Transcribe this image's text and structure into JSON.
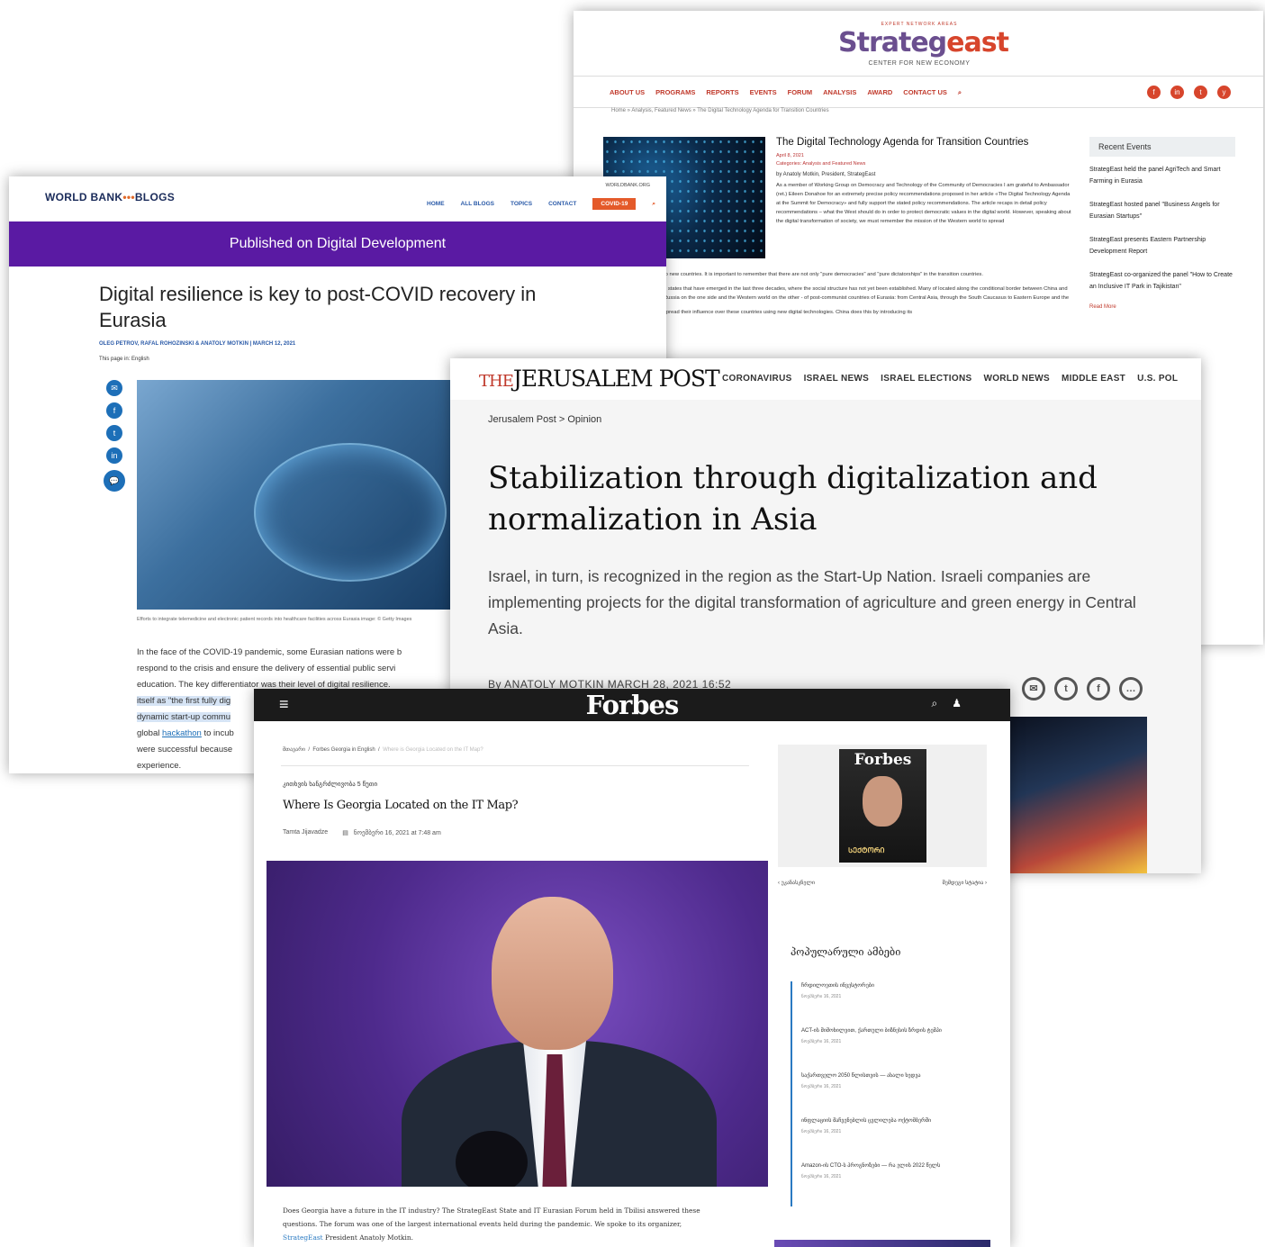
{
  "strategeast": {
    "tagline": "EXPERT NETWORK AREAS",
    "logo_a": "Strateg",
    "logo_b": "east",
    "subtitle": "CENTER FOR NEW ECONOMY",
    "nav": [
      "ABOUT US",
      "PROGRAMS",
      "REPORTS",
      "EVENTS",
      "FORUM",
      "ANALYSIS",
      "AWARD",
      "CONTACT US"
    ],
    "search_icon": "search-icon",
    "social": [
      "f",
      "in",
      "t",
      "y"
    ],
    "breadcrumb": "Home » Analysis, Featured News » The Digital Technology Agenda for Transition Countries",
    "title": "The Digital Technology Agenda for Transition Countries",
    "date": "April 8, 2021",
    "categories": "Categories: Analysis and Featured News",
    "author": "by Anatoly Motkin, President, StrategEast",
    "body": [
      "As a member of Working Group on Democracy and Technology of the Community of Democracies I am grateful to Ambassador (ret.) Eileen Donahoe for an extremely precise policy recommendations proposed in her article «The Digital Technology Agenda at the Summit for Democracy» and fully support the stated policy recommendations. The article recaps in detail policy recommendations – what the West should do in order to protect democratic values in the digital world. However, speaking about the digital transformation of society, we must remember the mission of the Western world to spread",
      "to new countries. It is important to remember that there are not only \"pure democracies\" and \"pure dictatorships\" in the transition countries.",
      "d states that have emerged in the last three decades, where the social structure has not yet been established. Many of located along the conditional border between China and Russia on the one side and the Western world on the other - of post-communist countries of Eurasia: from Central Asia, through the South Caucasus to Eastern Europe and the",
      "spread their influence over these countries using new digital technologies. China does this by introducing its"
    ],
    "sidebar_title": "Recent Events",
    "sidebar_items": [
      "StrategEast held the panel AgriTech and Smart Farming in Eurasia",
      "StrategEast hosted panel \"Business Angels for Eurasian Startups\"",
      "StrategEast presents Eastern Partnership Development Report",
      "StrategEast co-organized the panel \"How to Create an Inclusive IT Park in Tajikistan\""
    ],
    "read_more": "Read More"
  },
  "worldbank": {
    "logo_left": "WORLD BANK",
    "logo_dots": "•••",
    "logo_right": "BLOGS",
    "domain": "WORLDBANK.ORG",
    "nav": [
      "HOME",
      "ALL BLOGS",
      "TOPICS",
      "CONTACT"
    ],
    "covid": "COVID-19",
    "banner": "Published on Digital Development",
    "title": "Digital resilience is key to post-COVID recovery in Eurasia",
    "authors": "OLEG PETROV, RAFAL ROHOZINSKI & ANATOLY MOTKIN  |  MARCH 12, 2021",
    "language": "This page in:  English",
    "share": [
      "✉",
      "f",
      "t",
      "in",
      "💬"
    ],
    "caption": "Efforts to integrate telemedicine and electronic patient records into healthcare facilities across Eurasia image: © Getty Images",
    "body_1": "In the face of the COVID-19 pandemic, some Eurasian nations were b",
    "body_2": "respond to the crisis and ensure the delivery of essential public servi",
    "body_3": "education. The key differentiator was their level of digital resilience.",
    "body_4": "itself as \"the first fully dig",
    "body_5": "dynamic start-up commu",
    "body_6a": "global ",
    "body_6b": "hackathon",
    "body_6c": " to incub",
    "body_7": "were successful because",
    "body_8": "experience."
  },
  "jpost": {
    "logo_the": "THE",
    "logo_name": "JERUSALEM POST",
    "nav": [
      "CORONAVIRUS",
      "ISRAEL NEWS",
      "ISRAEL ELECTIONS",
      "WORLD NEWS",
      "MIDDLE EAST",
      "U.S. POL"
    ],
    "breadcrumb": "Jerusalem Post  >  Opinion",
    "title": "Stabilization through digitalization and normalization in Asia",
    "subtitle": "Israel, in turn, is recognized in the region as the Start-Up Nation. Israeli companies are implementing projects for the digital transformation of agriculture and green energy in Central Asia.",
    "byline": "By ANATOLY MOTKIN   MARCH 28, 2021 16:52",
    "share": [
      "✉",
      "t",
      "f",
      "…"
    ]
  },
  "forbes": {
    "menu_icon": "≡",
    "logo": "Forbes",
    "search_icon": "⌕",
    "profile_icon": "♟",
    "breadcrumb_home": "მთავარი",
    "breadcrumb_section": "Forbes Georgia in English",
    "breadcrumb_current": "Where is Georgia Located on the IT Map?",
    "kicker": "კითხვის ხანგრძლივობა 5 წუთი",
    "title": "Where Is Georgia Located on the IT Map?",
    "author": "Tamta Jijavadze",
    "date": "ნოემბერი 16, 2021 at 7:48 am",
    "lead_1": "Does Georgia have a future in the IT industry? The StrategEast State and IT Eurasian Forum held in Tbilisi answered these",
    "lead_2": "questions. The forum was one of the largest international events held during the pandemic. We spoke to its organizer,",
    "lead_3a": "StrategEast",
    "lead_3b": " President Anatoly Motkin.",
    "cover_logo": "Forbes",
    "cover_tag": "ᲡᲔᲥᲢᲝᲠᲘ",
    "prev": "‹ უკანასკნელი",
    "next": "შემდეგი სტატია ›",
    "popular_title": "პოპულარული ამბები",
    "popular": [
      {
        "t": "ჩრდილოეთის ინვესტორები",
        "d": "ნოემბერი 16, 2021"
      },
      {
        "t": "ACT-ის მიმოხილვით, ქართული ბიზნესის ზრდის ტემპი",
        "d": "ნოემბერი 16, 2021"
      },
      {
        "t": "საქართველო 2050 წლისთვის — ახალი ხედვა",
        "d": "ნოემბერი 16, 2021"
      },
      {
        "t": "ინფლაციის მაჩვენებლის ცვლილება ოქტომბერში",
        "d": "ნოემბერი 16, 2021"
      },
      {
        "t": "Amazon-ის CTO-ს პროგნოზები — რა ელის 2022 წელს",
        "d": "ნოემბერი 16, 2021"
      }
    ]
  }
}
